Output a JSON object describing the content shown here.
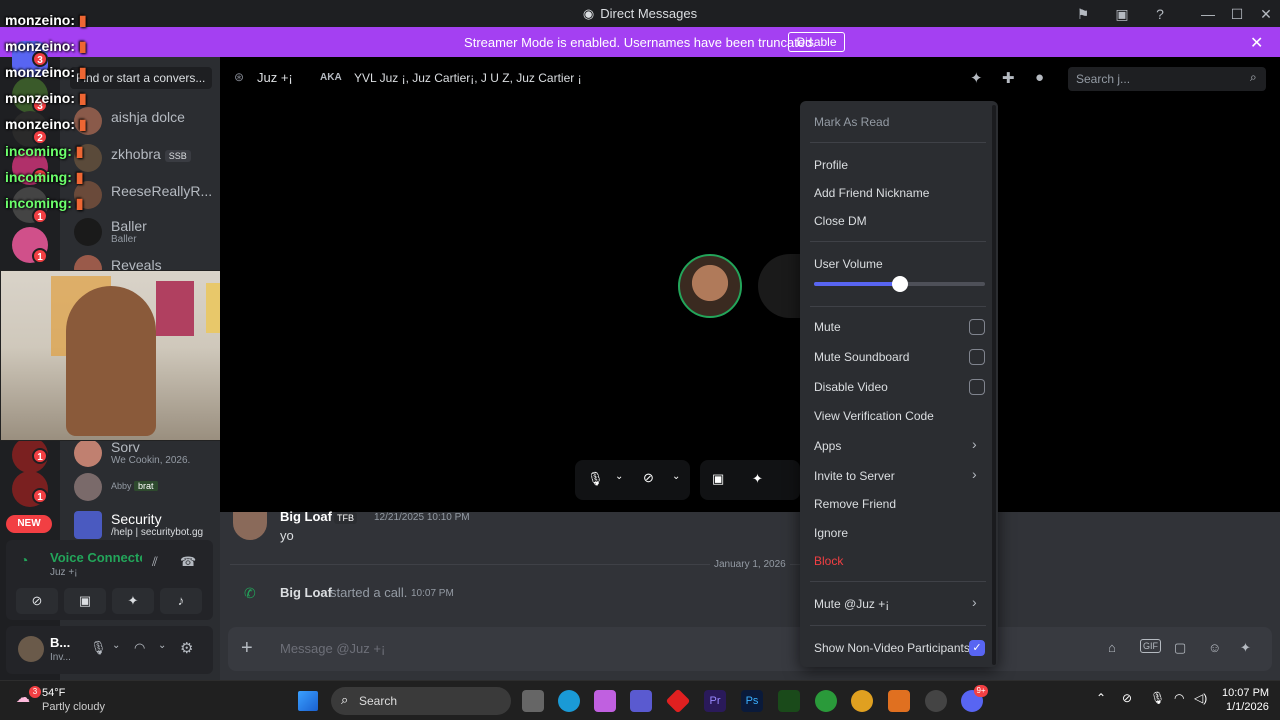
{
  "window": {
    "title": "Direct Messages"
  },
  "banner": {
    "message": "Streamer Mode is enabled. Usernames have been truncated.",
    "button": "Disable"
  },
  "dm_search": {
    "placeholder": "Find or start a convers..."
  },
  "dm_list": [
    {
      "name": "aishja dolce",
      "sub": ""
    },
    {
      "name": "zkhobra",
      "sub": "",
      "tag": "SSB"
    },
    {
      "name": "ReeseReallyR...",
      "sub": ""
    },
    {
      "name": "Baller",
      "sub": "Baller"
    },
    {
      "name": "Reveals",
      "sub": ""
    },
    {
      "name": "Sorv",
      "sub": "We Cookin, 2026."
    },
    {
      "name": "Abby",
      "sub": "brat"
    },
    {
      "name": "Security",
      "sub": "/help | securitybot.gg"
    }
  ],
  "rail_badges": [
    "3",
    "3",
    "2",
    "1",
    "1",
    "1",
    "1",
    "1"
  ],
  "rail_new": "NEW",
  "overlay_chat": [
    {
      "user": "monzeino:",
      "color": "#ffffff"
    },
    {
      "user": "monzeino:",
      "color": "#ffffff"
    },
    {
      "user": "monzeino:",
      "color": "#ffffff"
    },
    {
      "user": "monzeino:",
      "color": "#ffffff"
    },
    {
      "user": "monzeino:",
      "color": "#ffffff"
    },
    {
      "user": "incoming:",
      "color": "#6cff6c"
    },
    {
      "user": "incoming:",
      "color": "#6cff6c"
    },
    {
      "user": "incoming:",
      "color": "#6cff6c"
    }
  ],
  "header": {
    "name": "Juz +¡",
    "aka_label": "AKA",
    "aka": "YVL Juz ¡, Juz Cartier¡, J U Z, Juz Cartier ¡",
    "search_placeholder": "Search j..."
  },
  "voice_panel": {
    "status": "Voice Connecte",
    "channel": "Juz +¡"
  },
  "user_panel": {
    "name": "B...",
    "status": "Inv..."
  },
  "messages": [
    {
      "author": "Big Loaf",
      "tag": "TFB",
      "time": "12/21/2025 10:10 PM",
      "text": "yo"
    }
  ],
  "divider": "January 1, 2026",
  "call_msg": {
    "author": "Big Loaf",
    "text": "started a call.",
    "time": "10:07 PM"
  },
  "composer": {
    "placeholder": "Message @Juz +¡"
  },
  "context_menu": {
    "mark_read": "Mark As Read",
    "profile": "Profile",
    "nickname": "Add Friend Nickname",
    "close_dm": "Close DM",
    "user_volume": "User Volume",
    "volume_level": 0.5,
    "mute": "Mute",
    "mute_soundboard": "Mute Soundboard",
    "disable_video": "Disable Video",
    "verification": "View Verification Code",
    "apps": "Apps",
    "invite": "Invite to Server",
    "remove_friend": "Remove Friend",
    "ignore": "Ignore",
    "block": "Block",
    "mute_user": "Mute @Juz +¡",
    "show_non_video": "Show Non-Video Participants"
  },
  "taskbar": {
    "weather_temp": "54°F",
    "weather_desc": "Partly cloudy",
    "weather_badge": "3",
    "search": "Search",
    "time": "10:07 PM",
    "date": "1/1/2026",
    "discord_badge": "9+"
  },
  "colors": {
    "accent": "#5865f2",
    "banner": "#a440f2",
    "danger": "#f23f43",
    "green": "#23a55a"
  }
}
